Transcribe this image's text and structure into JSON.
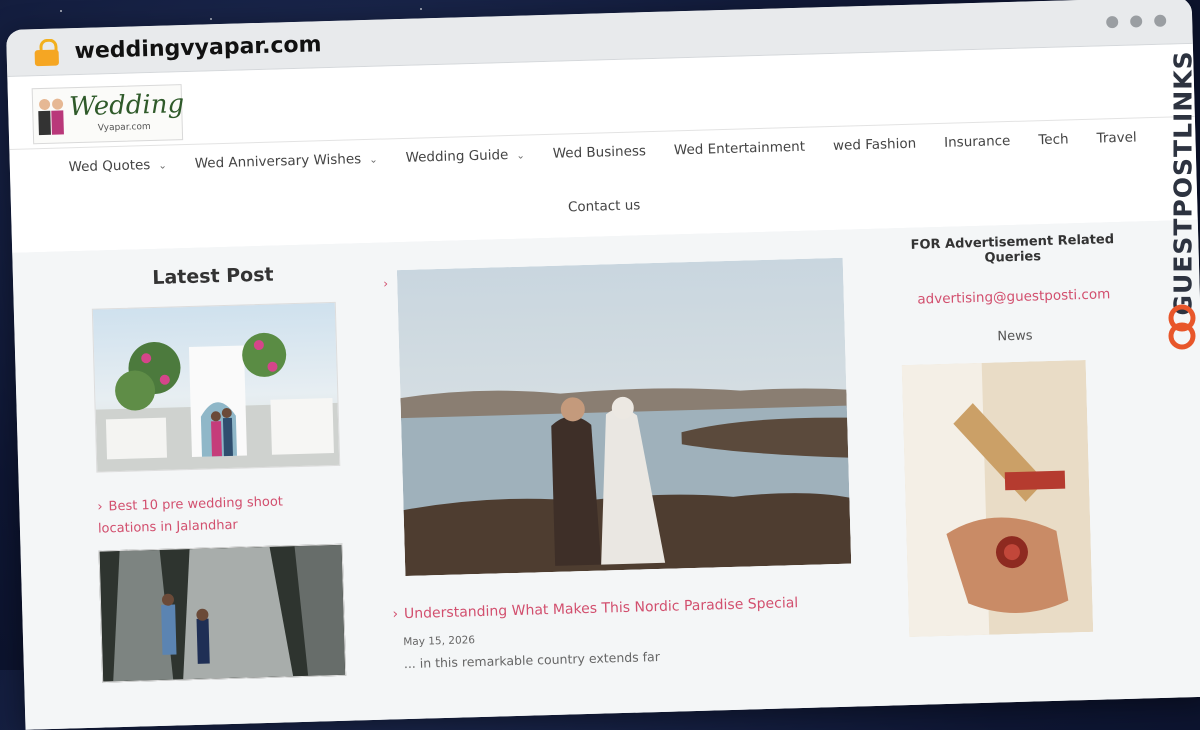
{
  "browser": {
    "url": "weddingvyapar.com"
  },
  "site": {
    "logo_text": "Wedding",
    "logo_sub": "Vyapar.com"
  },
  "nav": {
    "items": [
      {
        "label": "Wed Quotes",
        "dropdown": true
      },
      {
        "label": "Wed Anniversary Wishes",
        "dropdown": true
      },
      {
        "label": "Wedding Guide",
        "dropdown": true
      },
      {
        "label": "Wed Business",
        "dropdown": false
      },
      {
        "label": "Wed Entertainment",
        "dropdown": false
      },
      {
        "label": "wed Fashion",
        "dropdown": false
      },
      {
        "label": "Insurance",
        "dropdown": false
      },
      {
        "label": "Tech",
        "dropdown": false
      },
      {
        "label": "Travel",
        "dropdown": false
      }
    ],
    "row2": "Contact us"
  },
  "left": {
    "title": "Latest Post",
    "post1": "Best 10 pre wedding shoot locations in Jalandhar"
  },
  "center": {
    "title": "Understanding What Makes This Nordic Paradise Special",
    "date": "May 15, 2026",
    "excerpt": "... in this remarkable country extends far"
  },
  "right": {
    "ad_title": "FOR Advertisement Related Queries",
    "email": "advertising@guestposti.com",
    "news_label": "News"
  },
  "badge": {
    "text": "GUESTPOSTLINKS"
  },
  "colors": {
    "accent": "#d24f6e",
    "badge_orange": "#e8562a"
  }
}
